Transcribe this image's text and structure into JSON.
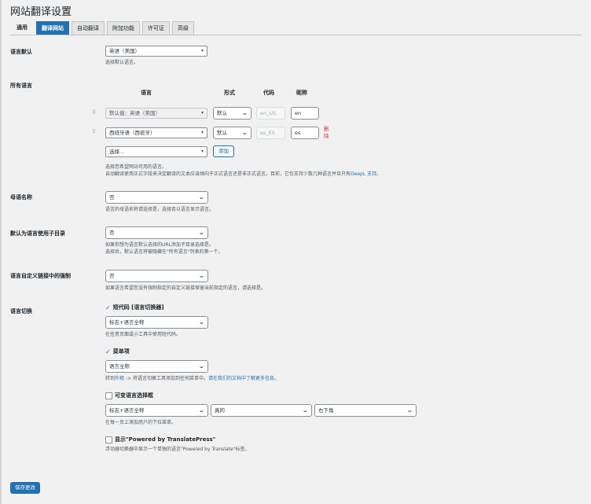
{
  "page": {
    "title": "网站翻译设置"
  },
  "tabs": [
    {
      "label": "通用"
    },
    {
      "label": "翻译网站"
    },
    {
      "label": "自动翻译"
    },
    {
      "label": "附加功能"
    },
    {
      "label": "许可证"
    },
    {
      "label": "高级"
    }
  ],
  "default_language": {
    "label": "语言默认",
    "value": "英语（美国）",
    "description": "选择默认语言。"
  },
  "all_languages": {
    "label": "所有语言",
    "columns": {
      "language": "语言",
      "format": "形式",
      "code": "代码",
      "slug": "昵称"
    },
    "rows": [
      {
        "language": "默认值：英语（美国）",
        "format": "默认",
        "code": "en_US",
        "slug": "en",
        "remove": ""
      },
      {
        "language": "西班牙语（西班牙）",
        "format": "默认",
        "code": "es_ES",
        "slug": "es",
        "remove": "删除"
      }
    ],
    "select_placeholder": "选择...",
    "add_button": "添加",
    "description_line1": "选择您希望网站可用的语言。",
    "description_line2_prefix": "自动翻译使用正式字段来决定翻译的文本应该倾向于正式语言还是非正式语言。目前，它仅支持少数几种语言并且只有",
    "description_line2_link": "DeepL 支持",
    "description_line2_suffix": "。"
  },
  "native_name": {
    "label": "母语名称",
    "value": "否",
    "description": "语言的母语名称请选择是，选择否以语言显示语言。"
  },
  "subdirectory": {
    "label": "默认为语言使用子目录",
    "value": "否",
    "description_line1": "如果你想为语言默认选择的URL添加子目录选择是。",
    "description_line2": "选择后，默认语言将被隐藏在\"所有语言\"列表的第一个。"
  },
  "force_custom_links": {
    "label": "语言自定义链接中的强制",
    "value": "否",
    "description": "如果语言希望您没有强制指定的自定义链接保留当前指定的语言，请选择是。"
  },
  "language_switcher": {
    "label": "语言切换",
    "shortcode": {
      "title": "短代码 [语言切换器]",
      "value": "标志+语言全称",
      "description": "在任意页面或小工具中使用短代码。"
    },
    "menu_item": {
      "title": "菜单项",
      "value": "语言全称",
      "desc_prefix": "转到",
      "desc_link1": "外观",
      "desc_middle": " -> 将语言切换工具添加到任何菜单中。",
      "desc_link2": "请在我们的文档中了解更多信息",
      "desc_suffix": "。"
    },
    "floating": {
      "title": "可变语言选择框",
      "value1": "标志+语言全称",
      "value2": "真的",
      "value3": "右下角",
      "description": "在每一页上添加用户的下拉菜单。"
    },
    "powered_by": {
      "title": "显示\"Powered by TranslatePress\"",
      "description": "浮动器切换器中显示一个单独的语言\"Powered by Translate\"标签。"
    }
  },
  "save_button": "保存更改"
}
